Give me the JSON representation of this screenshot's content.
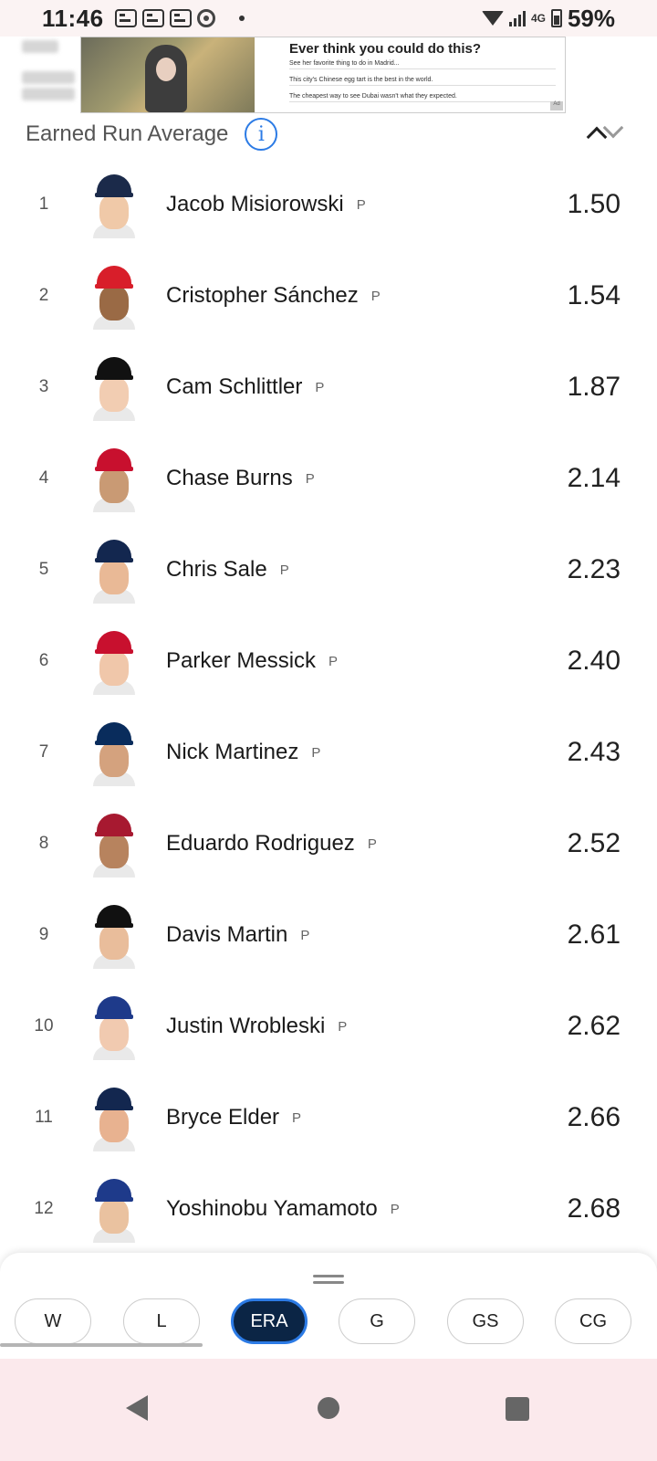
{
  "status_bar": {
    "time": "11:46",
    "network": "4G",
    "battery": "59%"
  },
  "ad": {
    "title": "Ever think you could do this?",
    "lines": [
      "See her favorite thing to do in Madrid...",
      "This city's Chinese egg tart is the best in the world.",
      "The cheapest way to see Dubai wasn't what they expected."
    ],
    "badge": "Ad"
  },
  "section": {
    "title": "Earned Run Average",
    "info_icon": "i"
  },
  "players": [
    {
      "rank": "1",
      "name": "Jacob Misiorowski",
      "pos": "P",
      "value": "1.50",
      "cap": "#1b2a4a",
      "skin": "#f0c9a8"
    },
    {
      "rank": "2",
      "name": "Cristopher Sánchez",
      "pos": "P",
      "value": "1.54",
      "cap": "#d81e2a",
      "skin": "#9a6a45"
    },
    {
      "rank": "3",
      "name": "Cam Schlittler",
      "pos": "P",
      "value": "1.87",
      "cap": "#111111",
      "skin": "#f2cdb2"
    },
    {
      "rank": "4",
      "name": "Chase Burns",
      "pos": "P",
      "value": "2.14",
      "cap": "#c8102e",
      "skin": "#c99a74"
    },
    {
      "rank": "5",
      "name": "Chris Sale",
      "pos": "P",
      "value": "2.23",
      "cap": "#13274f",
      "skin": "#e9b996"
    },
    {
      "rank": "6",
      "name": "Parker Messick",
      "pos": "P",
      "value": "2.40",
      "cap": "#c8102e",
      "skin": "#f0c7aa"
    },
    {
      "rank": "7",
      "name": "Nick Martinez",
      "pos": "P",
      "value": "2.43",
      "cap": "#092c5c",
      "skin": "#d4a27e"
    },
    {
      "rank": "8",
      "name": "Eduardo Rodriguez",
      "pos": "P",
      "value": "2.52",
      "cap": "#a71930",
      "skin": "#b7835e"
    },
    {
      "rank": "9",
      "name": "Davis Martin",
      "pos": "P",
      "value": "2.61",
      "cap": "#111111",
      "skin": "#e9bd9b"
    },
    {
      "rank": "10",
      "name": "Justin Wrobleski",
      "pos": "P",
      "value": "2.62",
      "cap": "#1e3a8a",
      "skin": "#f1cab0"
    },
    {
      "rank": "11",
      "name": "Bryce Elder",
      "pos": "P",
      "value": "2.66",
      "cap": "#13274f",
      "skin": "#e8b290"
    },
    {
      "rank": "12",
      "name": "Yoshinobu Yamamoto",
      "pos": "P",
      "value": "2.68",
      "cap": "#1e3a8a",
      "skin": "#eac2a0"
    }
  ],
  "stat_tabs": [
    "W",
    "L",
    "ERA",
    "G",
    "GS",
    "CG"
  ],
  "active_tab": "ERA",
  "colors": {
    "accent": "#2c7be5",
    "active_chip_bg": "#0b2545",
    "nav_bg": "#fbe9ec"
  }
}
